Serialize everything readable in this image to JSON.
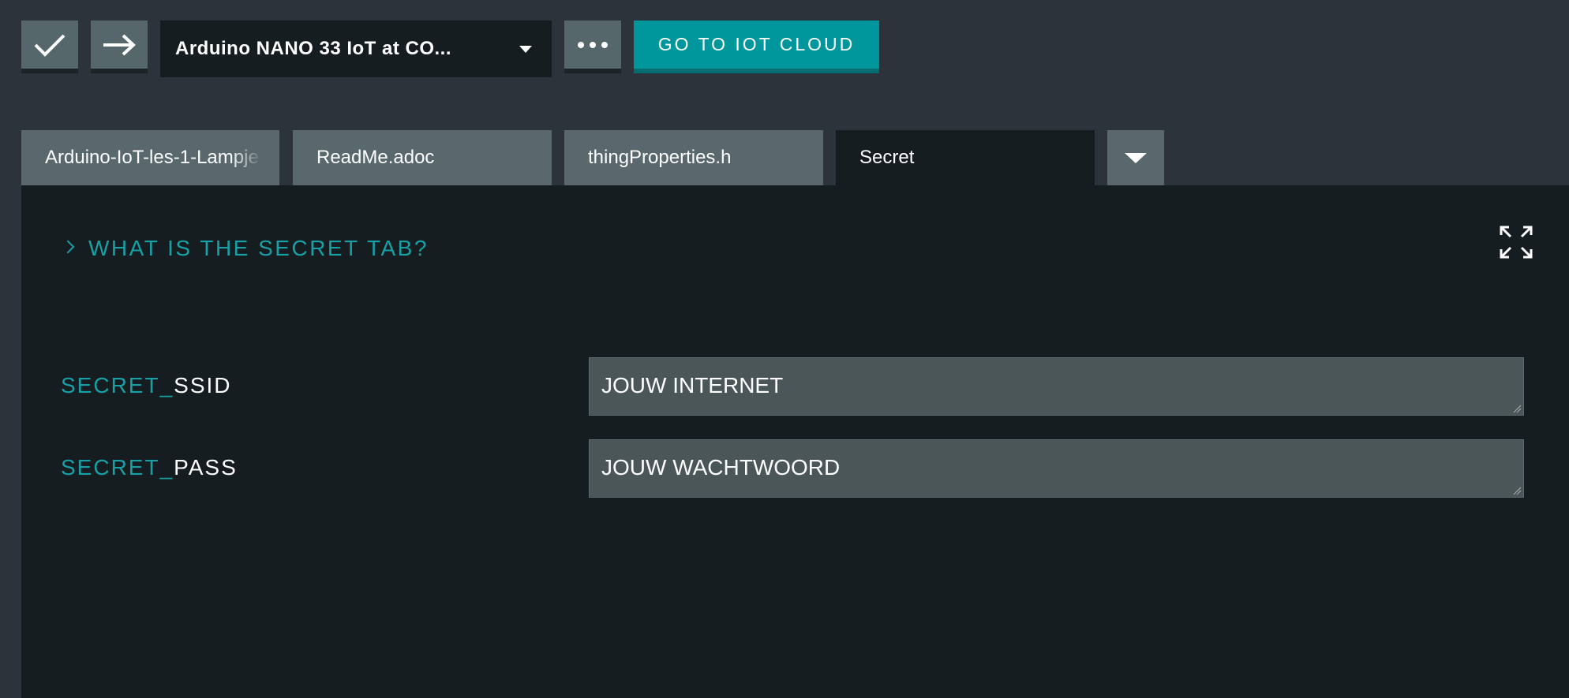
{
  "toolbar": {
    "verify_icon": "check-icon",
    "upload_icon": "arrow-right-icon",
    "board_selector": "Arduino NANO 33 IoT at CO...",
    "more_icon": "ellipsis-icon",
    "iot_cloud_label": "GO TO IOT CLOUD"
  },
  "tabs": [
    {
      "label": "Arduino-IoT-les-1-Lampje"
    },
    {
      "label": "ReadMe.adoc"
    },
    {
      "label": "thingProperties.h"
    },
    {
      "label": "Secret"
    }
  ],
  "secret_panel": {
    "help_title": "WHAT IS THE SECRET TAB?",
    "fields": [
      {
        "prefix": "SECRET_",
        "name": "SSID",
        "value": "JOUW INTERNET"
      },
      {
        "prefix": "SECRET_",
        "name": "PASS",
        "value": "JOUW WACHTWOORD"
      }
    ]
  },
  "colors": {
    "accent": "#00979c",
    "panel_bg": "#161d20",
    "toolbar_bg": "#2c333b",
    "tab_inactive": "#58686c"
  }
}
